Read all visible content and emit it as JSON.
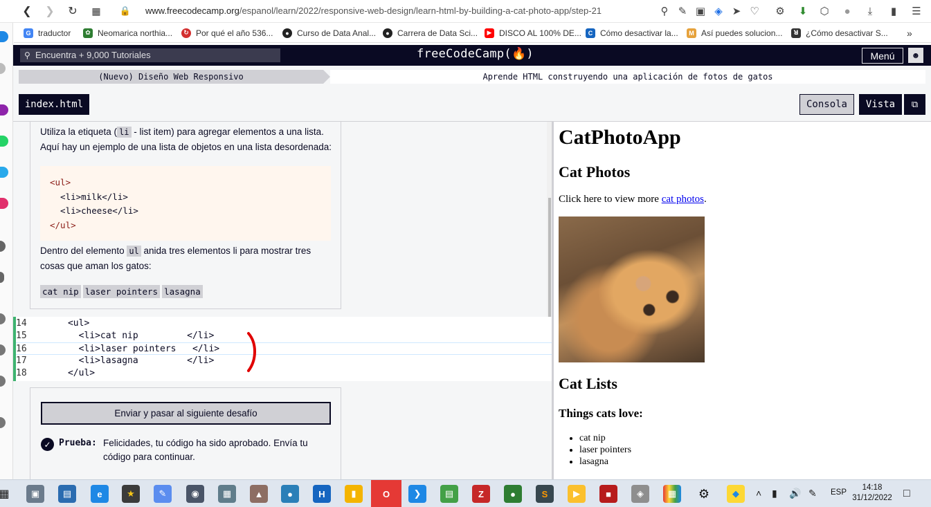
{
  "browser": {
    "url_host": "www.freecodecamp.org",
    "url_path": "/espanol/learn/2022/responsive-web-design/learn-html-by-building-a-cat-photo-app/step-21",
    "bookmarks": [
      {
        "label": "traductor",
        "icon": "google-icon",
        "color": "#4285f4"
      },
      {
        "label": "Neomarica northia...",
        "icon": "plant-icon",
        "color": "#2e7d32"
      },
      {
        "label": "Por qué el año 536...",
        "icon": "red-circle-icon",
        "color": "#d32f2f"
      },
      {
        "label": "Curso de Data Anal...",
        "icon": "dark-logo-icon",
        "color": "#222222"
      },
      {
        "label": "Carrera de Data Sci...",
        "icon": "dark-logo-icon",
        "color": "#222222"
      },
      {
        "label": "DISCO AL 100% DE...",
        "icon": "youtube-icon",
        "color": "#ff0000"
      },
      {
        "label": "Cómo desactivar la...",
        "icon": "blue-logo-icon",
        "color": "#1565c0"
      },
      {
        "label": "Así puedes solucion...",
        "icon": "mc-logo-icon",
        "color": "#e6a23c"
      },
      {
        "label": "¿Cómo desactivar S...",
        "icon": "dark-logo-icon",
        "color": "#333333"
      }
    ]
  },
  "fcc": {
    "search_placeholder": "Encuentra + 9,000 Tutoriales",
    "logo": "freeCodeCamp(🔥)",
    "menu": "Menú",
    "crumb_course": "(Nuevo) Diseño Web Responsivo",
    "crumb_project": "Aprende HTML construyendo una aplicación de fotos de gatos",
    "file_tab": "index.html",
    "consola": "Consola",
    "vista": "Vista"
  },
  "description": {
    "p1_before": "Utiliza la etiqueta (",
    "p1_code": "li",
    "p1_after": " - list item) para agregar elementos a una lista. Aquí hay un ejemplo de una lista de objetos en una lista desordenada:",
    "example_lines": [
      "<ul>",
      "  <li>milk</li>",
      "  <li>cheese</li>",
      "</ul>"
    ],
    "p2_before": "Dentro del elemento ",
    "p2_code": "ul",
    "p2_after": " anida tres elementos li para mostrar tres cosas que aman los gatos:",
    "chips": [
      "cat nip",
      "laser pointers",
      "lasagna"
    ]
  },
  "editor": {
    "lines": [
      {
        "num": "14",
        "code": "      <ul>"
      },
      {
        "num": "15",
        "code": "        <li>cat nip         </li>"
      },
      {
        "num": "16",
        "code": "        <li>laser pointers   </li>"
      },
      {
        "num": "17",
        "code": "        <li>lasagna         </li>"
      },
      {
        "num": "18",
        "code": "      </ul>"
      }
    ]
  },
  "footer": {
    "submit": "Enviar y pasar al siguiente desafío",
    "test_label": "Prueba:",
    "test_message": "Felicidades, tu código ha sido aprobado. Envía tu código para continuar."
  },
  "preview": {
    "h1": "CatPhotoApp",
    "h2_photos": "Cat Photos",
    "p_before": "Click here to view more ",
    "p_link": "cat photos",
    "p_after": ".",
    "h2_lists": "Cat Lists",
    "h3": "Things cats love:",
    "items": [
      "cat nip",
      "laser pointers",
      "lasagna"
    ]
  },
  "taskbar": {
    "lang": "ESP",
    "time": "14:18",
    "date": "31/12/2022"
  }
}
